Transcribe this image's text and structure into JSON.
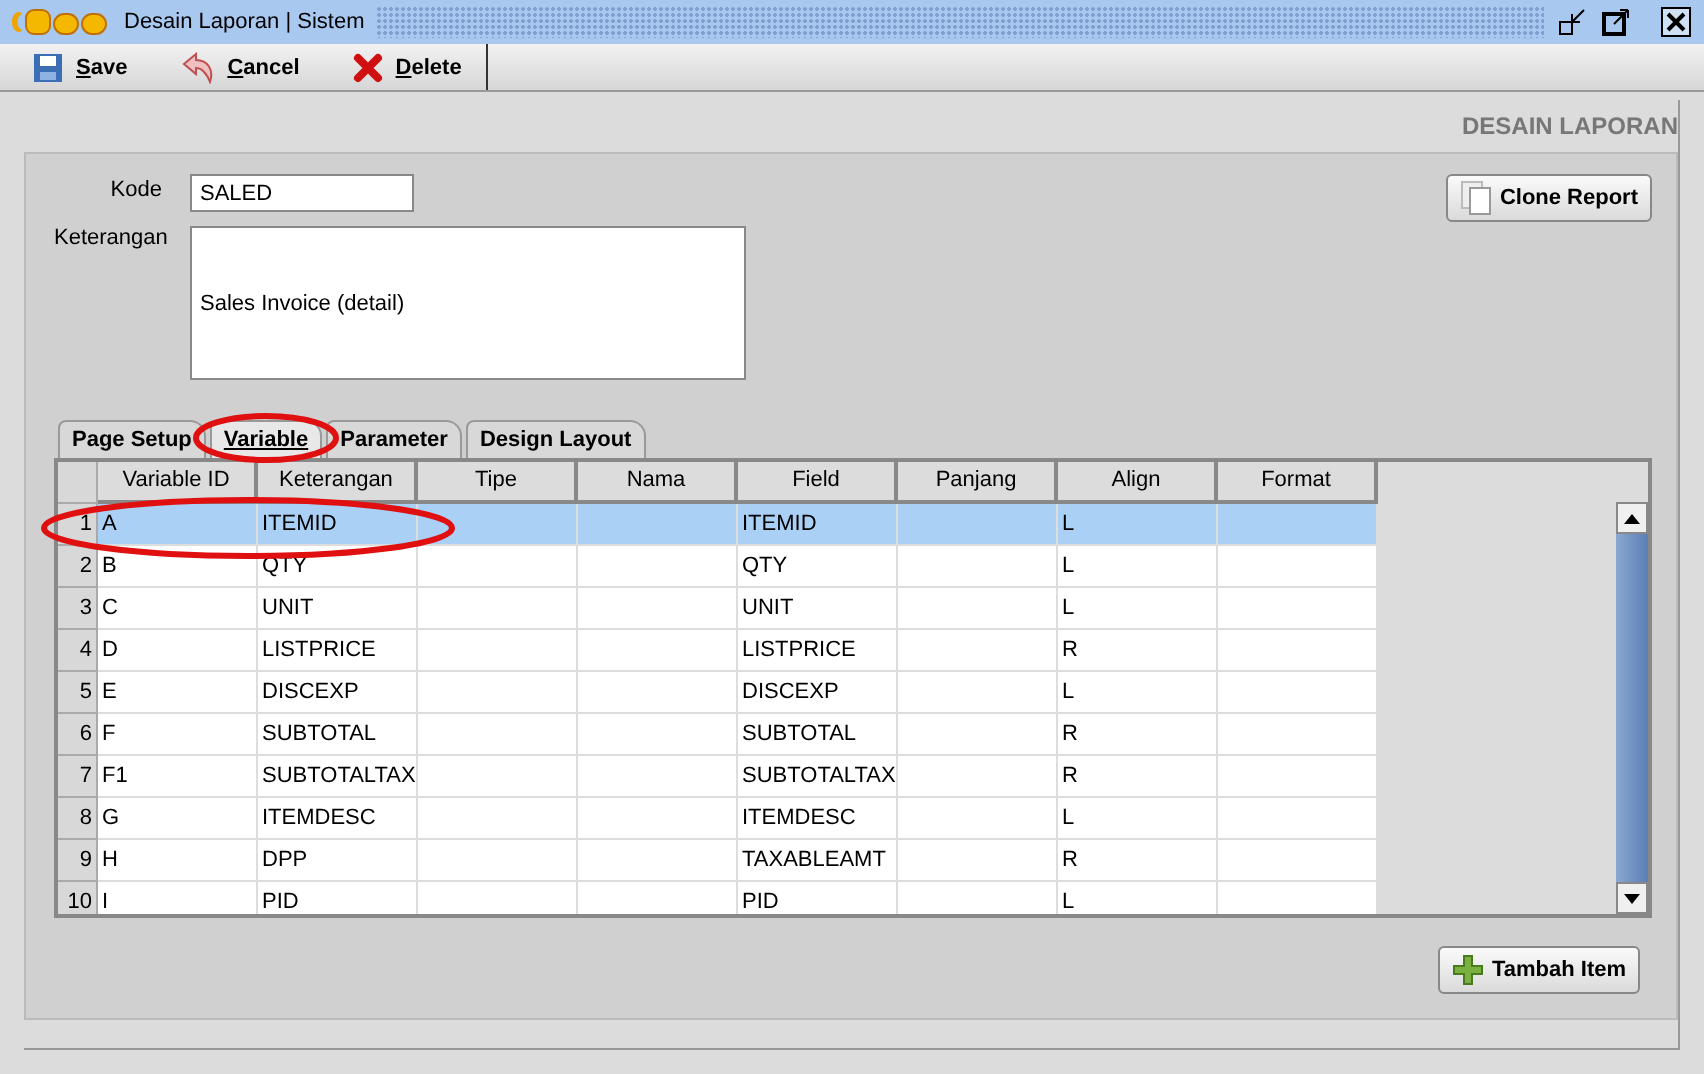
{
  "window": {
    "title": "Desain Laporan | Sistem"
  },
  "toolbar": [
    {
      "label": "Save",
      "kind": "save"
    },
    {
      "label": "Cancel",
      "kind": "cancel"
    },
    {
      "label": "Delete",
      "kind": "delete"
    }
  ],
  "header": "DESAIN LAPORAN",
  "form": {
    "kode_label": "Kode",
    "kode": "SALED",
    "keterangan_label": "Keterangan",
    "keterangan": "Sales Invoice (detail)"
  },
  "clone_button": "Clone Report",
  "tabs": [
    {
      "label": "Page Setup",
      "selected": false
    },
    {
      "label": "Variable",
      "selected": true
    },
    {
      "label": "Parameter",
      "selected": false
    },
    {
      "label": "Design Layout",
      "selected": false
    }
  ],
  "table": {
    "columns": [
      "Variable ID",
      "Keterangan",
      "Tipe",
      "Nama",
      "Field",
      "Panjang",
      "Align",
      "Format"
    ],
    "rows": [
      {
        "num": "1",
        "cells": [
          "A",
          "ITEMID",
          "",
          "",
          "ITEMID",
          "",
          "L",
          ""
        ],
        "selected": true
      },
      {
        "num": "2",
        "cells": [
          "B",
          "QTY",
          "",
          "",
          "QTY",
          "",
          "L",
          ""
        ],
        "selected": false
      },
      {
        "num": "3",
        "cells": [
          "C",
          "UNIT",
          "",
          "",
          "UNIT",
          "",
          "L",
          ""
        ],
        "selected": false
      },
      {
        "num": "4",
        "cells": [
          "D",
          "LISTPRICE",
          "",
          "",
          "LISTPRICE",
          "",
          "R",
          ""
        ],
        "selected": false
      },
      {
        "num": "5",
        "cells": [
          "E",
          "DISCEXP",
          "",
          "",
          "DISCEXP",
          "",
          "L",
          ""
        ],
        "selected": false
      },
      {
        "num": "6",
        "cells": [
          "F",
          "SUBTOTAL",
          "",
          "",
          "SUBTOTAL",
          "",
          "R",
          ""
        ],
        "selected": false
      },
      {
        "num": "7",
        "cells": [
          "F1",
          "SUBTOTALTAX",
          "",
          "",
          "SUBTOTALTAX",
          "",
          "R",
          ""
        ],
        "selected": false
      },
      {
        "num": "8",
        "cells": [
          "G",
          "ITEMDESC",
          "",
          "",
          "ITEMDESC",
          "",
          "L",
          ""
        ],
        "selected": false
      },
      {
        "num": "9",
        "cells": [
          "H",
          "DPP",
          "",
          "",
          "TAXABLEAMT",
          "",
          "R",
          ""
        ],
        "selected": false
      },
      {
        "num": "10",
        "cells": [
          "I",
          "PID",
          "",
          "",
          "PID",
          "",
          "L",
          ""
        ],
        "selected": false
      }
    ]
  },
  "add_button": "Tambah Item"
}
